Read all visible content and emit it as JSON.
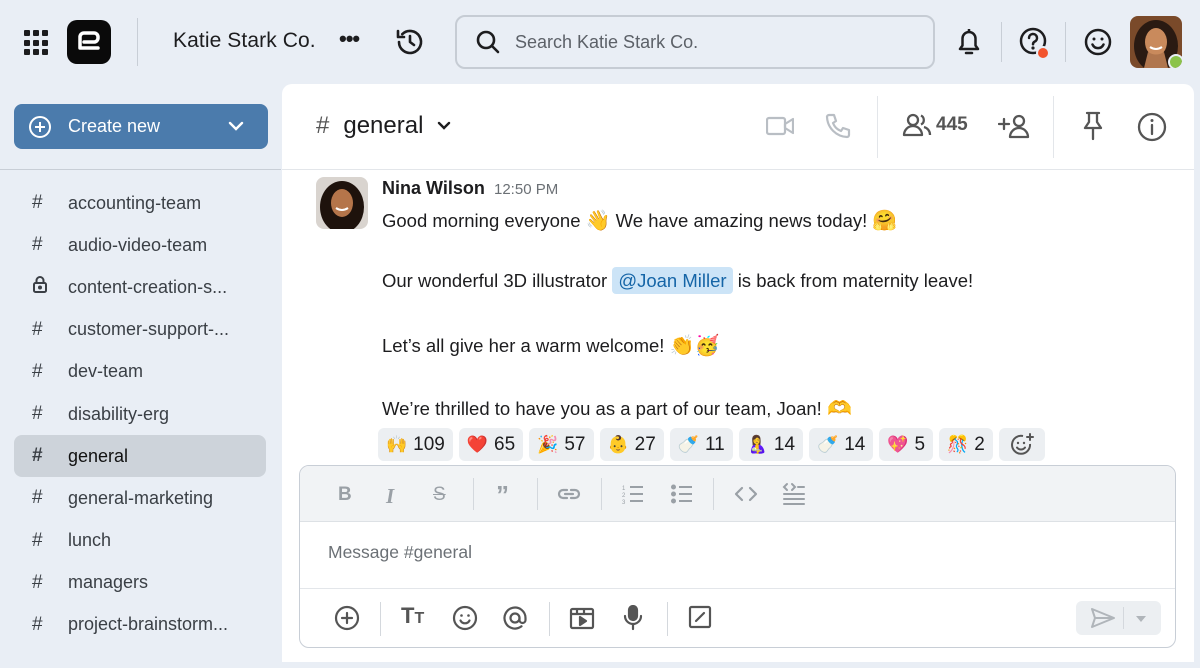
{
  "workspace": {
    "name": "Katie Stark Co."
  },
  "search": {
    "placeholder": "Search Katie Stark Co."
  },
  "sidebar": {
    "create_label": "Create new",
    "channels": [
      {
        "name": "accounting-team",
        "icon": "hash"
      },
      {
        "name": "audio-video-team",
        "icon": "hash"
      },
      {
        "name": "content-creation-s...",
        "icon": "lock"
      },
      {
        "name": "customer-support-...",
        "icon": "hash"
      },
      {
        "name": "dev-team",
        "icon": "hash"
      },
      {
        "name": "disability-erg",
        "icon": "hash"
      },
      {
        "name": "general",
        "icon": "hash",
        "active": true
      },
      {
        "name": "general-marketing",
        "icon": "hash"
      },
      {
        "name": "lunch",
        "icon": "hash"
      },
      {
        "name": "managers",
        "icon": "hash"
      },
      {
        "name": "project-brainstorm...",
        "icon": "hash"
      }
    ]
  },
  "channel": {
    "hash": "#",
    "name": "general",
    "member_count": "445"
  },
  "message": {
    "author": "Nina Wilson",
    "time": "12:50 PM",
    "line1": "Good morning everyone",
    "line1_emoji": "👋",
    "line1b": "We have amazing news today!",
    "line1b_emoji": "🤗",
    "line2_pre": "Our wonderful 3D illustrator",
    "mention": "@Joan Miller",
    "line2_post": "is back from maternity leave!",
    "line3": "Let’s all give her a warm welcome!",
    "line3_emoji": "👏🥳",
    "line4": "We’re thrilled to have you as a part of our team, Joan!",
    "line4_emoji": "🫶"
  },
  "reactions": [
    {
      "emoji": "🙌",
      "count": "109"
    },
    {
      "emoji": "❤️",
      "count": "65"
    },
    {
      "emoji": "🎉",
      "count": "57"
    },
    {
      "emoji": "👶",
      "count": "27"
    },
    {
      "emoji": "🍼",
      "count": "11"
    },
    {
      "emoji": "🤱",
      "count": "14"
    },
    {
      "emoji": "🍼",
      "count": "14"
    },
    {
      "emoji": "💖",
      "count": "5"
    },
    {
      "emoji": "🎊",
      "count": "2"
    }
  ],
  "composer": {
    "placeholder": "Message #general"
  },
  "colors": {
    "accent": "#4b7bac",
    "mention_bg": "#cce4f7",
    "online": "#8bc34a",
    "help_badge": "#f2542d"
  }
}
